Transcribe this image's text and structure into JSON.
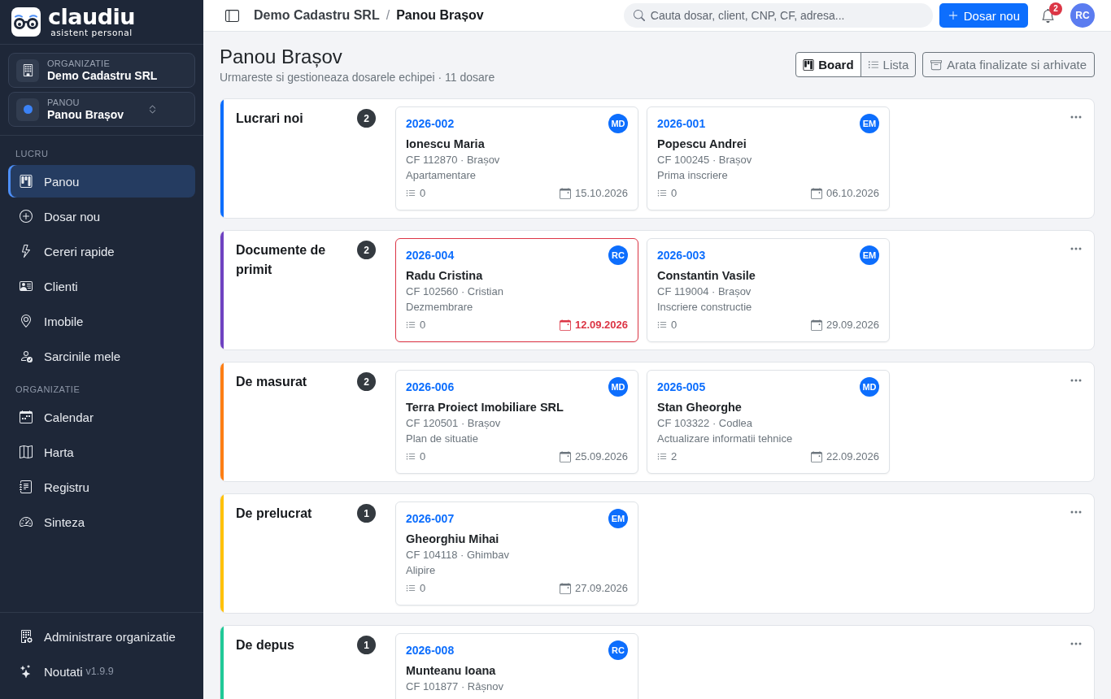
{
  "sidebar": {
    "logo": {
      "name": "claudiu",
      "tagline": "asistent personal"
    },
    "organization": {
      "label": "ORGANIZATIE",
      "value": "Demo Cadastru SRL"
    },
    "board": {
      "label": "PANOU",
      "value": "Panou Brașov"
    },
    "sections": [
      {
        "title": "LUCRU",
        "items": [
          {
            "label": "Panou",
            "selected": true
          },
          {
            "label": "Dosar nou",
            "selected": false
          },
          {
            "label": "Cereri rapide",
            "selected": false
          },
          {
            "label": "Clienti",
            "selected": false
          },
          {
            "label": "Imobile",
            "selected": false
          },
          {
            "label": "Sarcinile mele",
            "selected": false
          }
        ]
      },
      {
        "title": "ORGANIZATIE",
        "items": [
          {
            "label": "Calendar",
            "selected": false
          },
          {
            "label": "Harta",
            "selected": false
          },
          {
            "label": "Registru",
            "selected": false
          },
          {
            "label": "Sinteza",
            "selected": false
          }
        ]
      }
    ],
    "footer_items": [
      {
        "label": "Administrare organizatie"
      },
      {
        "label": "Noutati",
        "version": "v1.9.9"
      }
    ]
  },
  "topbar": {
    "breadcrumb": {
      "items": [
        "Demo Cadastru SRL",
        "Panou Brașov"
      ],
      "separator": "/"
    },
    "search": {
      "placeholder": "Cauta dosar, client, CNP, CF, adresa..."
    },
    "new_button": "Dosar nou",
    "notifications": "2",
    "user_initials": "RC"
  },
  "page": {
    "title": "Panou Brașov",
    "subtitle": "Urmareste si gestioneaza dosarele echipei · 11 dosare",
    "views": [
      {
        "label": "Board",
        "selected": true
      },
      {
        "label": "Lista",
        "selected": false
      }
    ],
    "archive_button": "Arata finalizate si arhivate"
  },
  "lanes": [
    {
      "title": "Lucrari noi",
      "count": "2",
      "color": "#0d6efd",
      "cards": [
        {
          "number": "2026-002",
          "assignee": "MD",
          "client": "Ionescu Maria",
          "cadastral": "CF 112870 · Brașov",
          "work_type": "Apartamentare",
          "tasks": "0",
          "due": "15.10.2026",
          "overdue": false
        },
        {
          "number": "2026-001",
          "assignee": "EM",
          "client": "Popescu Andrei",
          "cadastral": "CF 100245 · Brașov",
          "work_type": "Prima inscriere",
          "tasks": "0",
          "due": "06.10.2026",
          "overdue": false
        }
      ]
    },
    {
      "title": "Documente de primit",
      "count": "2",
      "color": "#6f42c1",
      "cards": [
        {
          "number": "2026-004",
          "assignee": "RC",
          "client": "Radu Cristina",
          "cadastral": "CF 102560 · Cristian",
          "work_type": "Dezmembrare",
          "tasks": "0",
          "due": "12.09.2026",
          "overdue": true
        },
        {
          "number": "2026-003",
          "assignee": "EM",
          "client": "Constantin Vasile",
          "cadastral": "CF 119004 · Brașov",
          "work_type": "Inscriere constructie",
          "tasks": "0",
          "due": "29.09.2026",
          "overdue": false
        }
      ]
    },
    {
      "title": "De masurat",
      "count": "2",
      "color": "#fd7e14",
      "cards": [
        {
          "number": "2026-006",
          "assignee": "MD",
          "client": "Terra Proiect Imobiliare SRL",
          "cadastral": "CF 120501 · Brașov",
          "work_type": "Plan de situatie",
          "tasks": "0",
          "due": "25.09.2026",
          "overdue": false
        },
        {
          "number": "2026-005",
          "assignee": "MD",
          "client": "Stan Gheorghe",
          "cadastral": "CF 103322 · Codlea",
          "work_type": "Actualizare informatii tehnice",
          "tasks": "2",
          "due": "22.09.2026",
          "overdue": false
        }
      ]
    },
    {
      "title": "De prelucrat",
      "count": "1",
      "color": "#ffc107",
      "cards": [
        {
          "number": "2026-007",
          "assignee": "EM",
          "client": "Gheorghiu Mihai",
          "cadastral": "CF 104118 · Ghimbav",
          "work_type": "Alipire",
          "tasks": "0",
          "due": "27.09.2026",
          "overdue": false
        }
      ]
    },
    {
      "title": "De depus",
      "count": "1",
      "color": "#20c997",
      "cards": [
        {
          "number": "2026-008",
          "assignee": "RC",
          "client": "Munteanu Ioana",
          "cadastral": "CF 101877 · Râșnov",
          "overdue": false
        }
      ]
    }
  ]
}
